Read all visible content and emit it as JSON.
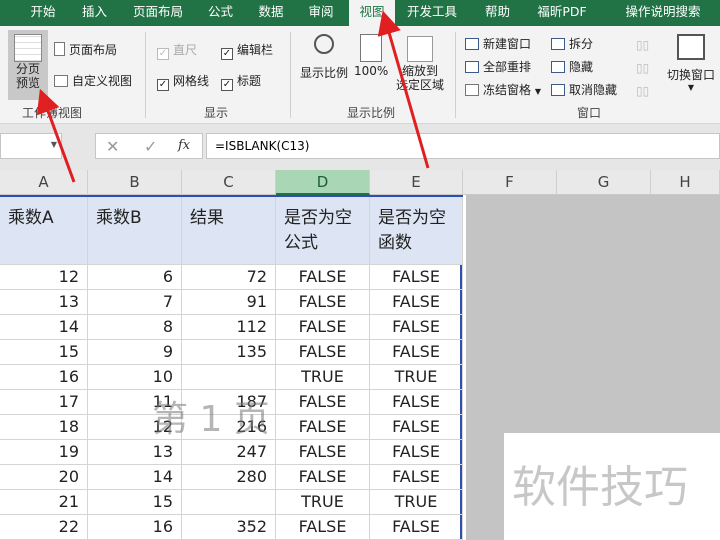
{
  "tabs": [
    "开始",
    "插入",
    "页面布局",
    "公式",
    "数据",
    "审阅",
    "视图",
    "开发工具",
    "帮助",
    "福昕PDF",
    "操作说明搜索"
  ],
  "active_tab": "视图",
  "ribbon": {
    "workbook_views": {
      "label": "工作簿视图",
      "page_break": "分页\n预览",
      "page_layout": "页面布局",
      "custom_views": "自定义视图"
    },
    "show": {
      "label": "显示",
      "ruler": "直尺",
      "formula_bar": "编辑栏",
      "gridlines": "网格线",
      "headings": "标题"
    },
    "zoom": {
      "label": "显示比例",
      "zoom": "显示比例",
      "hundred": "100%",
      "to_selection": "缩放到\n选定区域"
    },
    "window": {
      "label": "窗口",
      "new_window": "新建窗口",
      "arrange_all": "全部重排",
      "freeze": "冻结窗格",
      "split": "拆分",
      "hide": "隐藏",
      "unhide": "取消隐藏",
      "switch": "切换窗口"
    }
  },
  "formula": "=ISBLANK(C13)",
  "fx": "fx",
  "columns": [
    "A",
    "B",
    "C",
    "D",
    "E",
    "F",
    "G",
    "H"
  ],
  "header_row": [
    "乘数A",
    "乘数B",
    "结果",
    "是否为空\n公式",
    "是否为空\n函数"
  ],
  "rows": [
    [
      "12",
      "6",
      "72",
      "FALSE",
      "FALSE"
    ],
    [
      "13",
      "7",
      "91",
      "FALSE",
      "FALSE"
    ],
    [
      "14",
      "8",
      "112",
      "FALSE",
      "FALSE"
    ],
    [
      "15",
      "9",
      "135",
      "FALSE",
      "FALSE"
    ],
    [
      "16",
      "10",
      "",
      "TRUE",
      "TRUE"
    ],
    [
      "17",
      "11",
      "187",
      "FALSE",
      "FALSE"
    ],
    [
      "18",
      "12",
      "216",
      "FALSE",
      "FALSE"
    ],
    [
      "19",
      "13",
      "247",
      "FALSE",
      "FALSE"
    ],
    [
      "20",
      "14",
      "280",
      "FALSE",
      "FALSE"
    ],
    [
      "21",
      "15",
      "",
      "TRUE",
      "TRUE"
    ],
    [
      "22",
      "16",
      "352",
      "FALSE",
      "FALSE"
    ]
  ],
  "page_watermark": "第 1 页",
  "site_watermark": "软件技巧",
  "colors": {
    "brand": "#217346",
    "page_border": "#2e4fb0",
    "arrow": "#e02020"
  }
}
